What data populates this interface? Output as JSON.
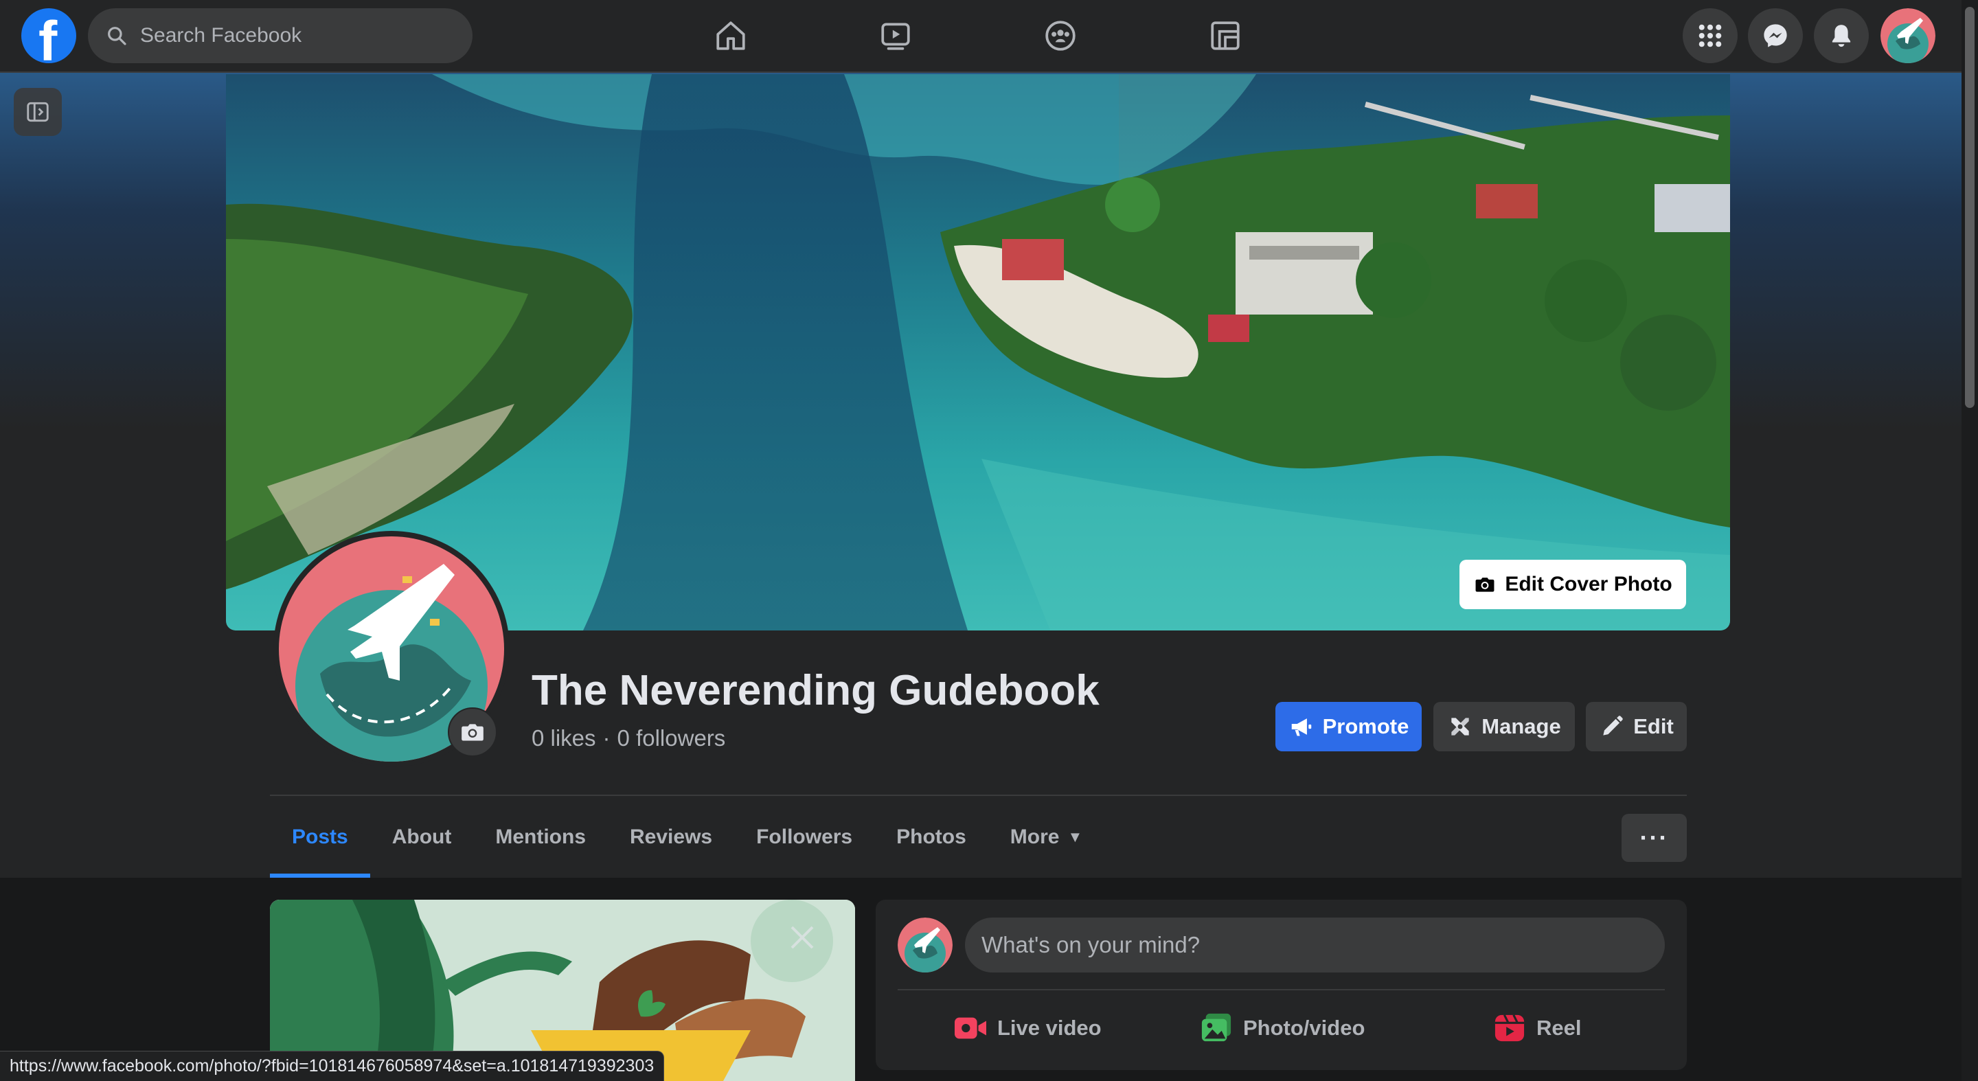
{
  "topbar": {
    "logo_letter": "f",
    "search_placeholder": "Search Facebook",
    "nav_icons": [
      "home-icon",
      "watch-icon",
      "groups-icon",
      "gaming-icon"
    ],
    "right_icons": [
      "menu-grid-icon",
      "messenger-icon",
      "notifications-bell-icon"
    ]
  },
  "cover": {
    "edit_cover_label": "Edit Cover Photo"
  },
  "page": {
    "name": "The Neverending Gudebook",
    "likes": "0 likes",
    "separator": "·",
    "followers": "0 followers"
  },
  "actions": {
    "promote": "Promote",
    "manage": "Manage",
    "edit": "Edit"
  },
  "tabs": [
    {
      "label": "Posts",
      "active": true
    },
    {
      "label": "About"
    },
    {
      "label": "Mentions"
    },
    {
      "label": "Reviews"
    },
    {
      "label": "Followers"
    },
    {
      "label": "Photos"
    },
    {
      "label": "More"
    }
  ],
  "tabs_more_dots": "···",
  "composer": {
    "placeholder": "What's on your mind?",
    "live_video": "Live video",
    "photo_video": "Photo/video",
    "reel": "Reel"
  },
  "status_bar": {
    "url": "https://www.facebook.com/photo/?fbid=101814676058974&set=a.101814719392303"
  },
  "colors": {
    "accent": "#2d88ff",
    "promote": "#2d6ce8",
    "surface": "#242526",
    "background": "#18191a",
    "live_red": "#f3425f",
    "photo_green": "#45bd62",
    "reel_pink": "#e42645"
  }
}
